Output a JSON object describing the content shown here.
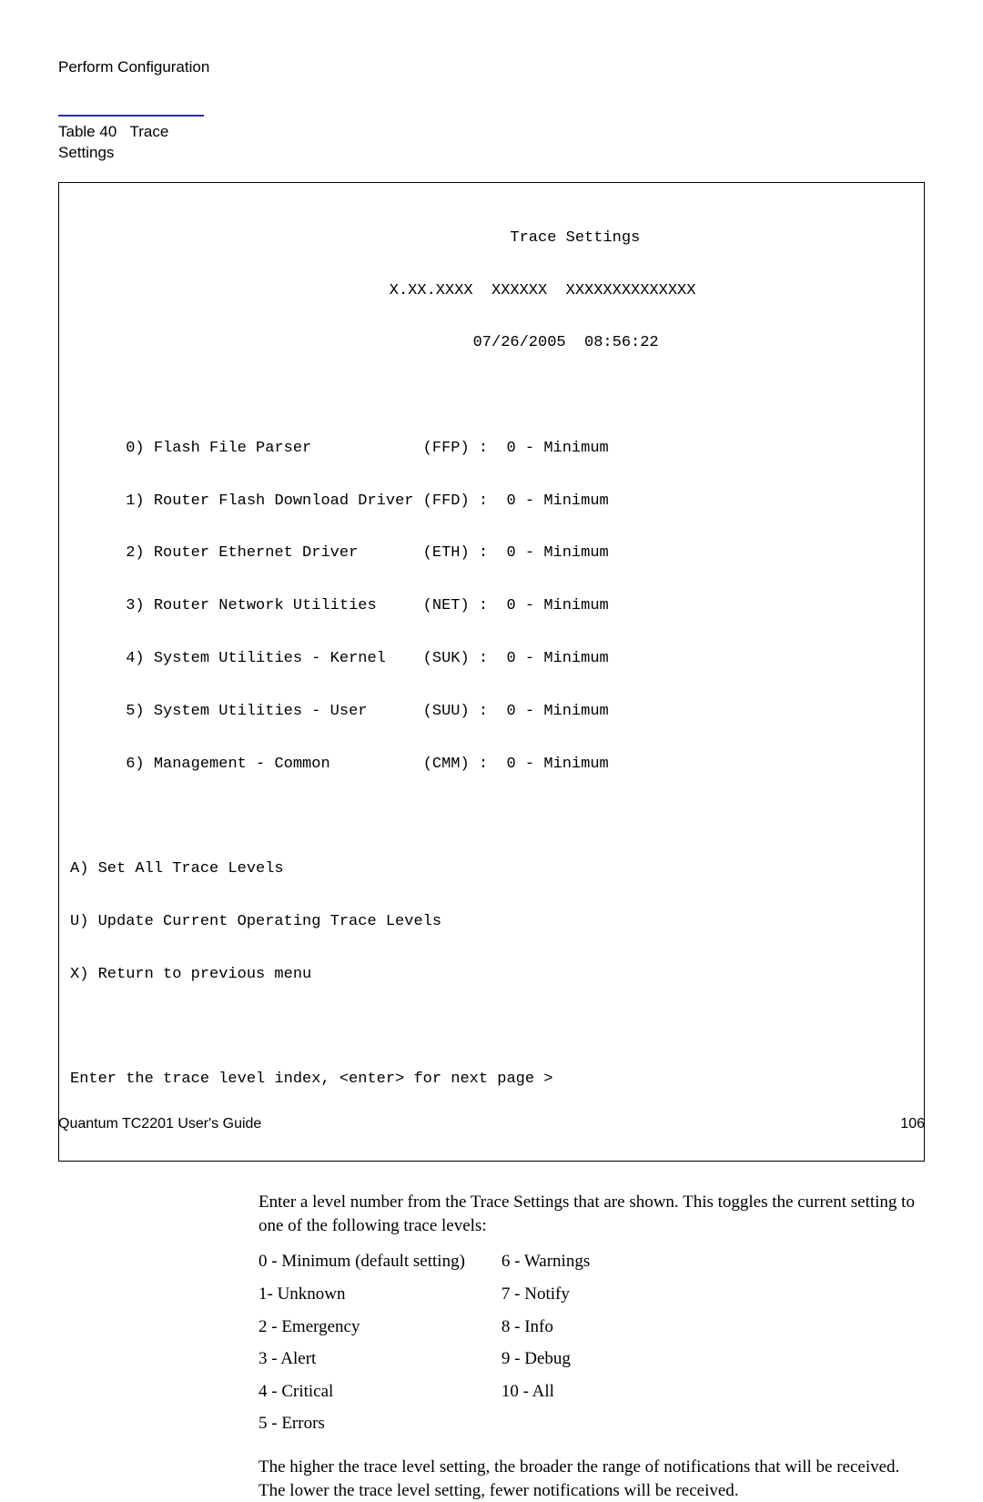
{
  "header": {
    "title": "Perform Configuration"
  },
  "table_caption": {
    "prefix": "Table 40",
    "name": "Trace Settings"
  },
  "terminal": {
    "title": "Trace Settings",
    "version_line": "X.XX.XXXX  XXXXXX  XXXXXXXXXXXXXX",
    "timestamp": "07/26/2005  08:56:22",
    "items": [
      {
        "idx": "0",
        "name": "Flash File Parser",
        "code": "FFP",
        "value": "0 - Minimum"
      },
      {
        "idx": "1",
        "name": "Router Flash Download Driver",
        "code": "FFD",
        "value": "0 - Minimum"
      },
      {
        "idx": "2",
        "name": "Router Ethernet Driver",
        "code": "ETH",
        "value": "0 - Minimum"
      },
      {
        "idx": "3",
        "name": "Router Network Utilities",
        "code": "NET",
        "value": "0 - Minimum"
      },
      {
        "idx": "4",
        "name": "System Utilities - Kernel",
        "code": "SUK",
        "value": "0 - Minimum"
      },
      {
        "idx": "5",
        "name": "System Utilities - User",
        "code": "SUU",
        "value": "0 - Minimum"
      },
      {
        "idx": "6",
        "name": "Management - Common",
        "code": "CMM",
        "value": "0 - Minimum"
      }
    ],
    "commands": [
      "A) Set All Trace Levels",
      "U) Update Current Operating Trace Levels",
      "X) Return to previous menu"
    ],
    "prompt": "Enter the trace level index, <enter> for next page >"
  },
  "body": {
    "p1": "Enter a level number from the Trace Settings that are shown. This toggles the current setting to one of the following trace levels:",
    "levels_left": [
      "0 - Minimum (default setting)",
      "1- Unknown",
      "2 - Emergency",
      "3 - Alert",
      "4 - Critical",
      "5 - Errors"
    ],
    "levels_right": [
      "6 - Warnings",
      "7 - Notify",
      "8 - Info",
      "9 - Debug",
      "10 - All",
      ""
    ],
    "p2": "The higher the trace level setting, the broader the range of notifications that will be received. The lower the trace level setting, fewer notifications will be received."
  },
  "footer": {
    "left": "Quantum TC2201 User's Guide",
    "right": "106"
  }
}
